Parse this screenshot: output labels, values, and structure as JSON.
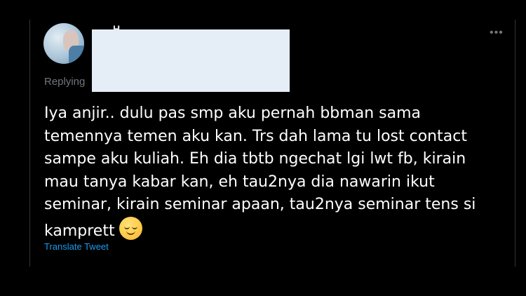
{
  "tweet": {
    "author_name_partial": "H",
    "replying_label": "Replying",
    "text": "Iya anjir.. dulu pas smp aku pernah bbman sama\ntemennya temen aku kan. Trs dah lama tu lost contact\nsampe aku kuliah. Eh dia tbtb ngechat lgi lwt fb, kirain\nmau tanya kabar kan, eh tau2nya dia nawarin ikut\nseminar, kirain seminar apaan, tau2nya seminar tens si\nkamprett",
    "emoji_icon": "relieved-face-icon",
    "translate_label": "Translate Tweet",
    "more_icon": "more-options-icon"
  },
  "colors": {
    "background": "#000000",
    "text": "#ffffff",
    "muted": "#71767b",
    "link": "#1d9bf0",
    "redaction": "#e5eef6"
  }
}
